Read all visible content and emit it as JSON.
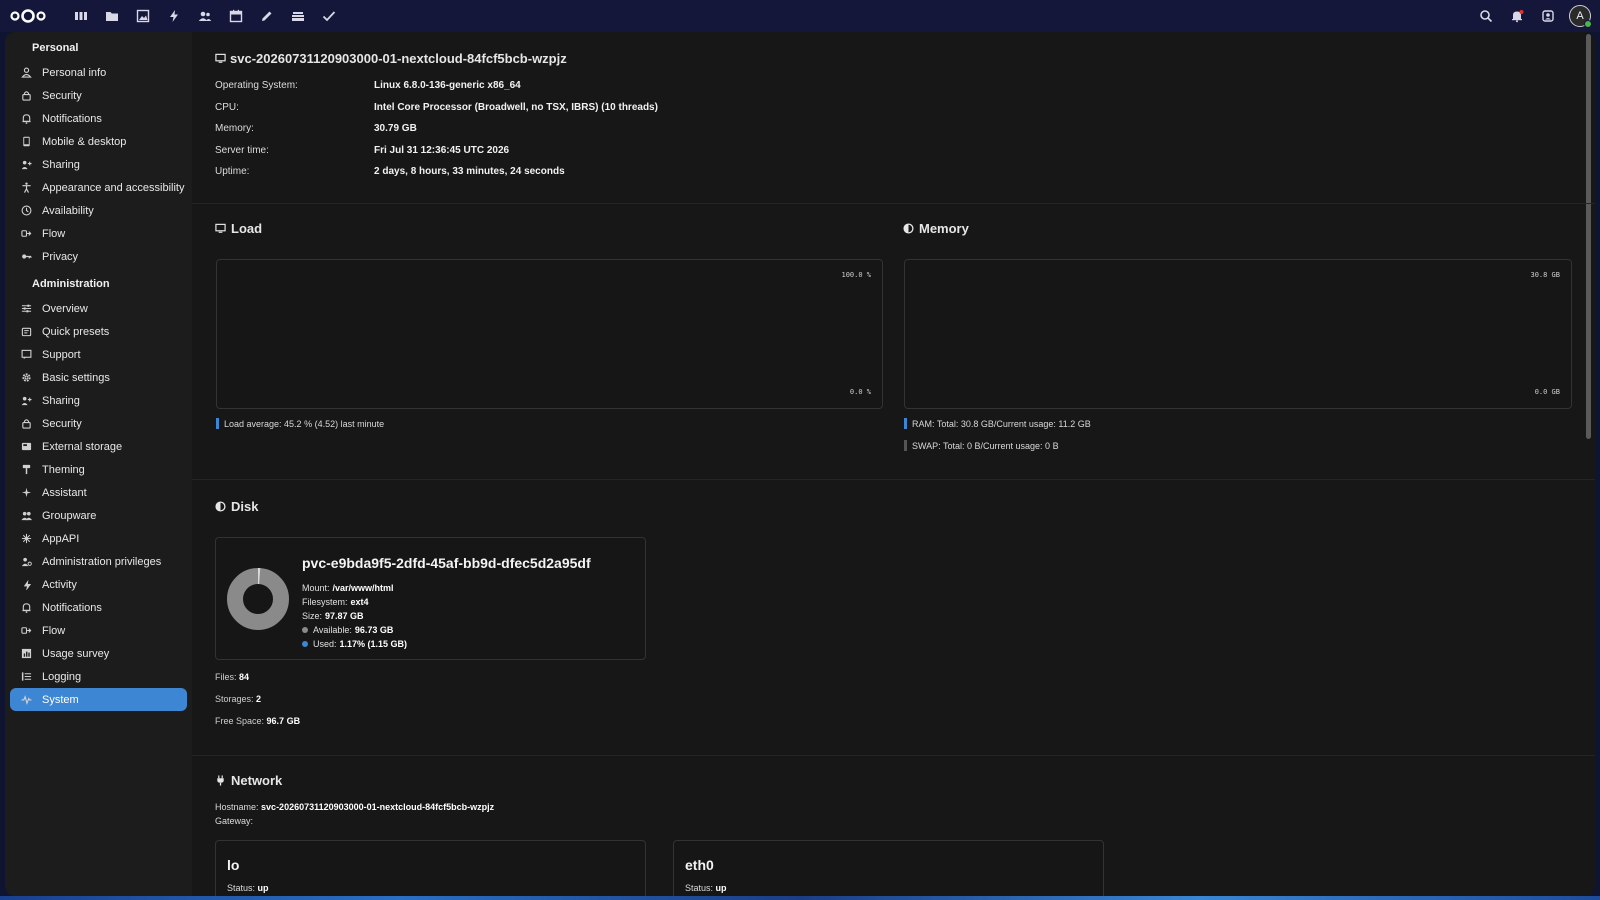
{
  "topbar": {
    "apps": [
      "dashboard-icon",
      "files-icon",
      "photos-icon",
      "activity-icon",
      "contacts-icon",
      "calendar-icon",
      "notes-icon",
      "deck-icon",
      "tasks-icon"
    ],
    "right_icons": [
      "search-icon",
      "notifications-icon",
      "contacts-menu-icon"
    ],
    "avatar_initial": "A"
  },
  "sidebar": {
    "personal_heading": "Personal",
    "personal": [
      {
        "label": "Personal info",
        "icon": "person-icon"
      },
      {
        "label": "Security",
        "icon": "lock-icon"
      },
      {
        "label": "Notifications",
        "icon": "bell-icon"
      },
      {
        "label": "Mobile & desktop",
        "icon": "phone-icon"
      },
      {
        "label": "Sharing",
        "icon": "share-icon"
      },
      {
        "label": "Appearance and accessibility",
        "icon": "accessibility-icon"
      },
      {
        "label": "Availability",
        "icon": "clock-icon"
      },
      {
        "label": "Flow",
        "icon": "flow-icon"
      },
      {
        "label": "Privacy",
        "icon": "key-icon"
      }
    ],
    "admin_heading": "Administration",
    "admin": [
      {
        "label": "Overview",
        "icon": "sliders-icon"
      },
      {
        "label": "Quick presets",
        "icon": "presets-icon"
      },
      {
        "label": "Support",
        "icon": "support-icon"
      },
      {
        "label": "Basic settings",
        "icon": "gear-icon"
      },
      {
        "label": "Sharing",
        "icon": "share-icon"
      },
      {
        "label": "Security",
        "icon": "lock-icon"
      },
      {
        "label": "External storage",
        "icon": "storage-icon"
      },
      {
        "label": "Theming",
        "icon": "brush-icon"
      },
      {
        "label": "Assistant",
        "icon": "sparkle-icon"
      },
      {
        "label": "Groupware",
        "icon": "group-icon"
      },
      {
        "label": "AppAPI",
        "icon": "api-icon"
      },
      {
        "label": "Administration privileges",
        "icon": "admin-icon"
      },
      {
        "label": "Activity",
        "icon": "activity-icon"
      },
      {
        "label": "Notifications",
        "icon": "bell-icon"
      },
      {
        "label": "Flow",
        "icon": "flow-icon"
      },
      {
        "label": "Usage survey",
        "icon": "chart-icon"
      },
      {
        "label": "Logging",
        "icon": "list-icon"
      },
      {
        "label": "System",
        "icon": "pulse-icon",
        "active": true
      }
    ]
  },
  "system": {
    "hostname_title": "svc-20260731120903000-01-nextcloud-84fcf5bcb-wzpjz",
    "rows": [
      {
        "key": "Operating System:",
        "value": "Linux 6.8.0-136-generic x86_64"
      },
      {
        "key": "CPU:",
        "value": "Intel Core Processor (Broadwell, no TSX, IBRS) (10 threads)"
      },
      {
        "key": "Memory:",
        "value": "30.79 GB"
      },
      {
        "key": "Server time:",
        "value": "Fri Jul 31 12:36:45 UTC 2026"
      },
      {
        "key": "Uptime:",
        "value": "2 days, 8 hours, 33 minutes, 24 seconds"
      }
    ]
  },
  "load": {
    "title": "Load",
    "top_label": "100.0 %",
    "bottom_label": "0.0 %",
    "legend": "Load average: 45.2 % (4.52) last minute",
    "color": "#3d86d4"
  },
  "memory": {
    "title": "Memory",
    "top_label": "30.8 GB",
    "bottom_label": "0.0 GB",
    "legend_ram": "RAM: Total: 30.8 GB/Current usage: 11.2 GB",
    "legend_swap": "SWAP: Total: 0 B/Current usage: 0 B",
    "ram_color": "#3d86d4",
    "swap_color": "#555555"
  },
  "disk": {
    "title": "Disk",
    "name": "pvc-e9bda9f5-2dfd-45af-bb9d-dfec5d2a95df",
    "mount_label": "Mount:",
    "mount": "/var/www/html",
    "fs_label": "Filesystem:",
    "fs": "ext4",
    "size_label": "Size:",
    "size": "97.87 GB",
    "avail_label": "Available:",
    "avail": "96.73 GB",
    "used_label": "Used:",
    "used": "1.17% (1.15 GB)",
    "used_fraction": 0.0117,
    "files_label": "Files:",
    "files": "84",
    "storages_label": "Storages:",
    "storages": "2",
    "free_label": "Free Space:",
    "free": "96.7 GB"
  },
  "network": {
    "title": "Network",
    "hostname_label": "Hostname:",
    "hostname": "svc-20260731120903000-01-nextcloud-84fcf5bcb-wzpjz",
    "gateway_label": "Gateway:",
    "interfaces": [
      {
        "name": "lo",
        "status_label": "Status:",
        "status": "up"
      },
      {
        "name": "eth0",
        "status_label": "Status:",
        "status": "up"
      }
    ]
  }
}
